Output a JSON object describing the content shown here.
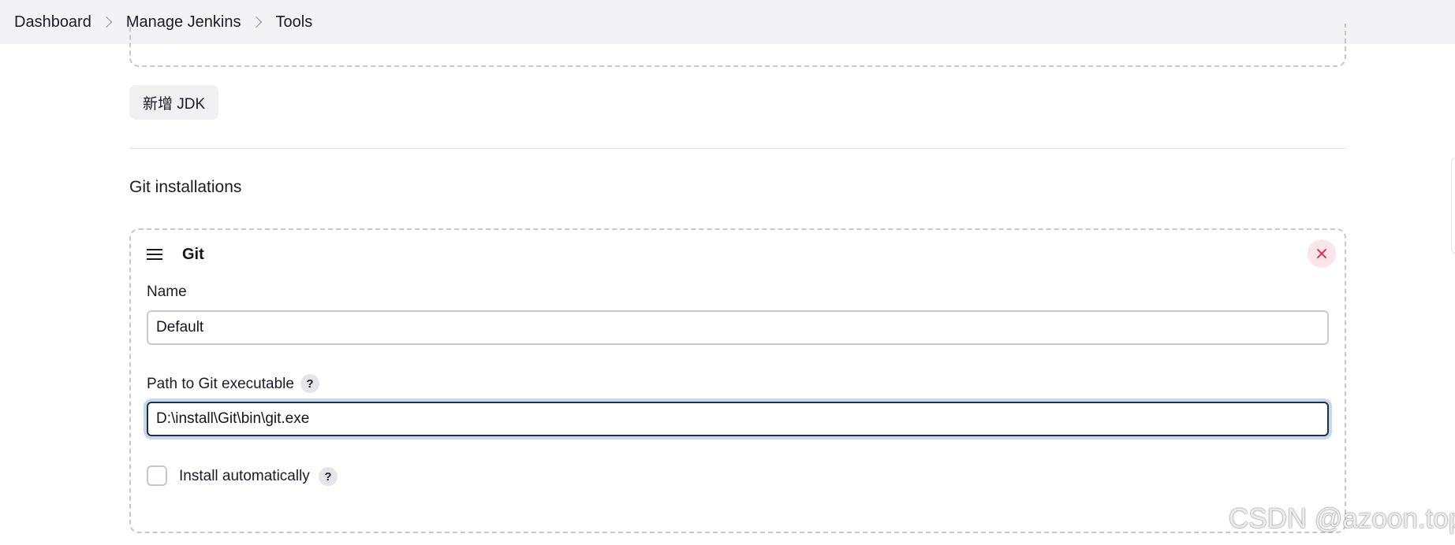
{
  "breadcrumb": {
    "items": [
      "Dashboard",
      "Manage Jenkins",
      "Tools"
    ]
  },
  "jdk": {
    "add_button_label": "新增 JDK"
  },
  "git_section": {
    "title": "Git installations",
    "installation": {
      "title": "Git",
      "name_label": "Name",
      "name_value": "Default",
      "path_label": "Path to Git executable",
      "path_value": "D:\\install\\Git\\bin\\git.exe",
      "install_auto_label": "Install automatically",
      "install_auto_checked": false,
      "help_glyph": "?"
    }
  },
  "watermark": "CSDN @azoon.top",
  "colors": {
    "topbar_bg": "#f3f3f5",
    "focus_border": "#1c2f4f",
    "focus_ring": "#c6d9ea",
    "close_bg": "#fbe5e8",
    "close_icon": "#e0233f"
  },
  "icons": {
    "breadcrumb_separator": "chevron-right-icon",
    "drag": "drag-handle-icon",
    "close": "close-icon",
    "help": "help-icon"
  }
}
